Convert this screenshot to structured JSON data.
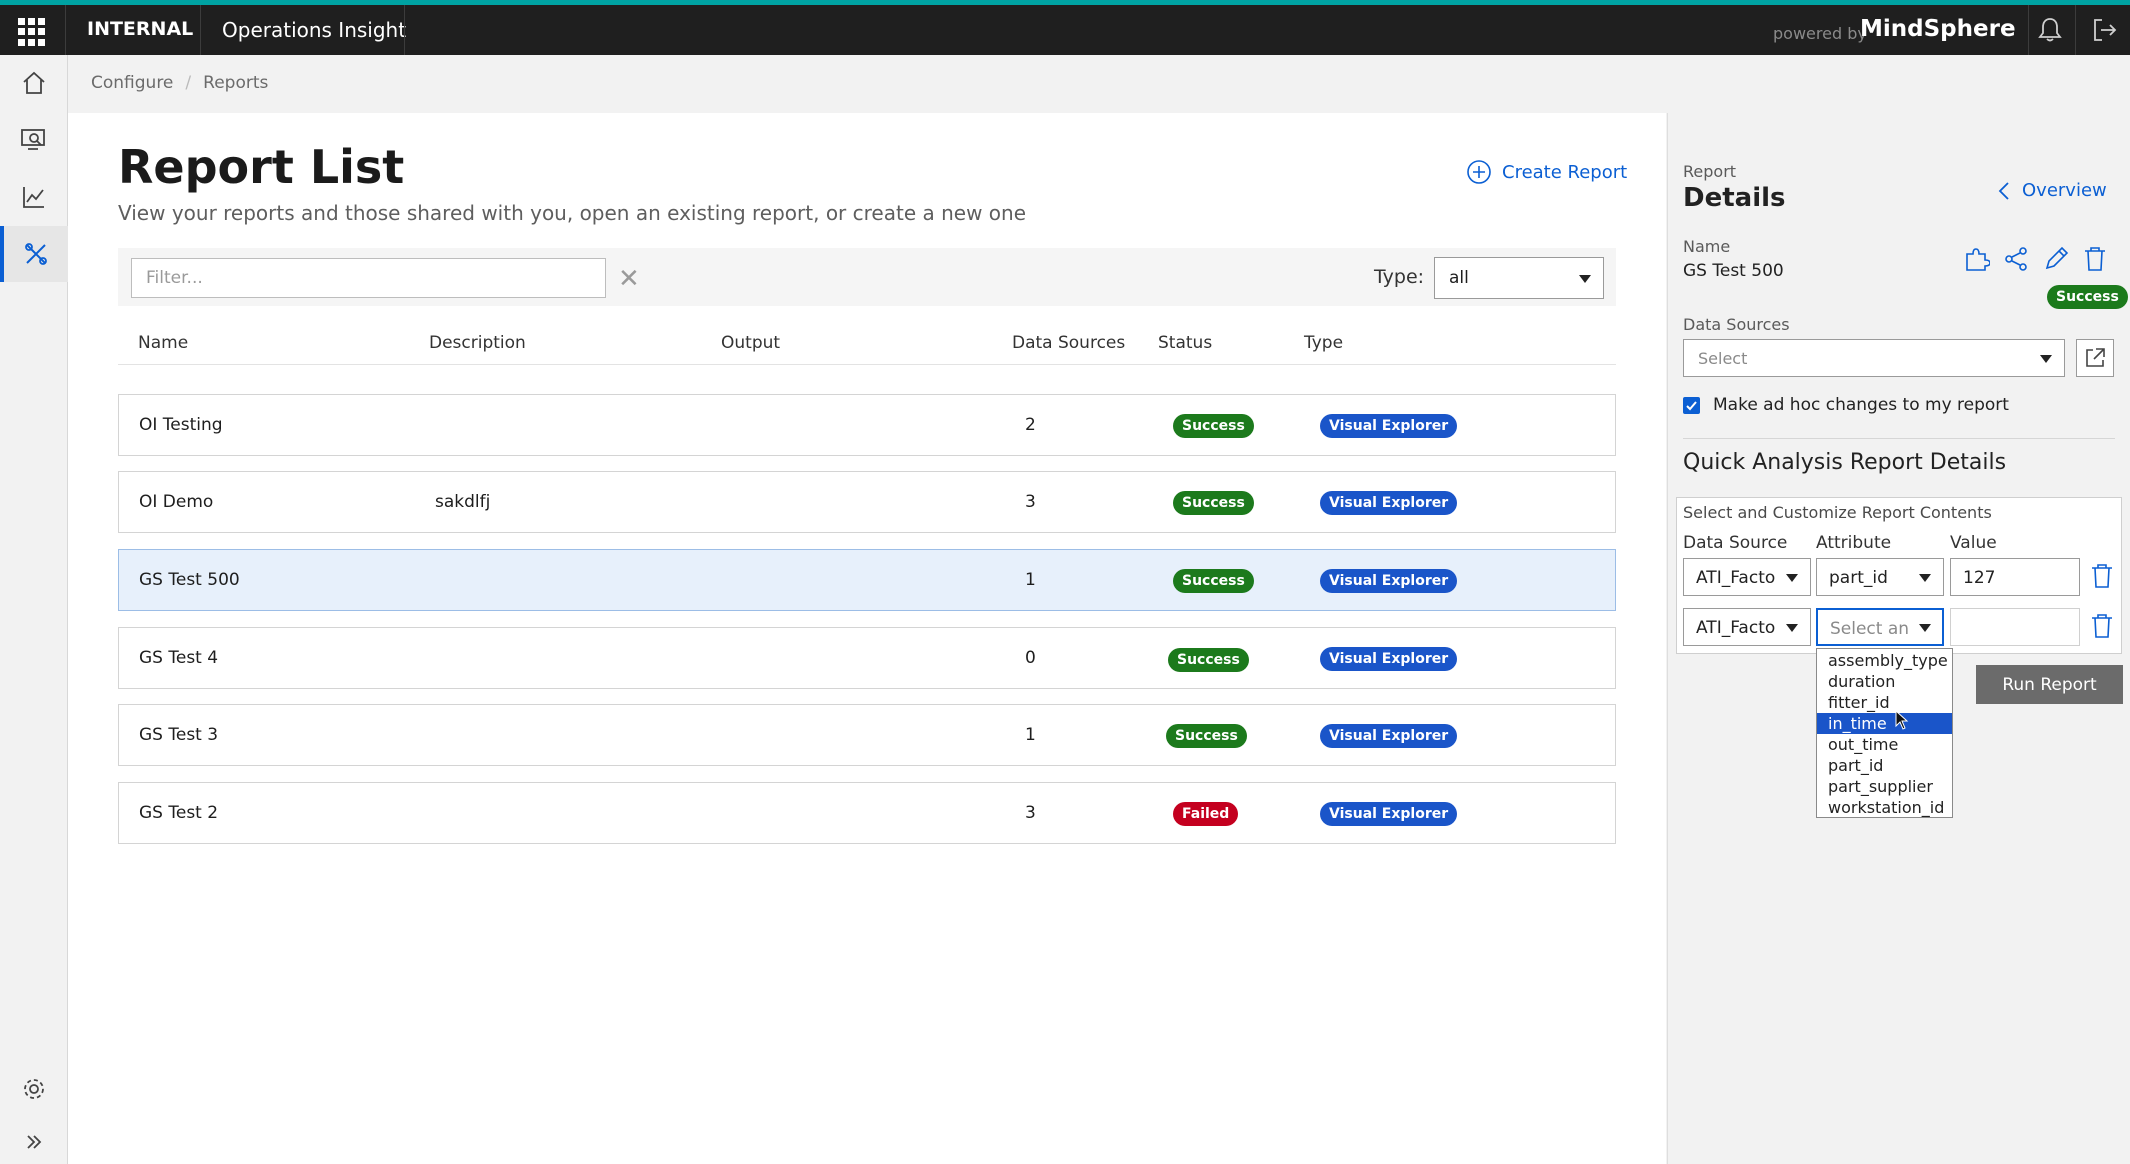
{
  "topbar": {
    "org": "INTERNAL",
    "app_name": "Operations Insight",
    "powered_by": "powered by",
    "brand": "MindSphere"
  },
  "breadcrumb": {
    "items": [
      "Configure",
      "Reports"
    ],
    "separator": "/"
  },
  "main": {
    "title": "Report List",
    "subtitle": "View your reports and those shared with you, open an existing report, or create a new one",
    "create_label": "Create Report",
    "filter": {
      "placeholder": "Filter...",
      "value": ""
    },
    "type_label": "Type:",
    "type_value": "all",
    "columns": [
      "Name",
      "Description",
      "Output",
      "Data Sources",
      "Status",
      "Type"
    ],
    "rows": [
      {
        "name": "OI Testing",
        "description": "",
        "output": "",
        "data_sources": "2",
        "status": "Success",
        "type": "Visual Explorer"
      },
      {
        "name": "OI Demo",
        "description": "sakdlfj",
        "output": "",
        "data_sources": "3",
        "status": "Success",
        "type": "Visual Explorer"
      },
      {
        "name": "GS Test 500",
        "description": "",
        "output": "",
        "data_sources": "1",
        "status": "Success",
        "type": "Visual Explorer",
        "selected": true
      },
      {
        "name": "GS Test 4",
        "description": "",
        "output": "",
        "data_sources": "0",
        "status": "Success",
        "type": "Visual Explorer"
      },
      {
        "name": "GS Test 3",
        "description": "",
        "output": "",
        "data_sources": "1",
        "status": "Success",
        "type": "Visual Explorer"
      },
      {
        "name": "GS Test 2",
        "description": "",
        "output": "",
        "data_sources": "3",
        "status": "Failed",
        "type": "Visual Explorer"
      }
    ]
  },
  "panel": {
    "overline": "Report",
    "title": "Details",
    "overview_label": "Overview",
    "name_label": "Name",
    "name_value": "GS Test 500",
    "status": "Success",
    "data_sources_label": "Data Sources",
    "data_sources_placeholder": "Select",
    "adhoc_label": "Make ad hoc changes to my report",
    "adhoc_checked": true,
    "qa_title": "Quick Analysis Report Details",
    "box_title": "Select and Customize Report Contents",
    "col_ds": "Data Source",
    "col_attr": "Attribute",
    "col_value": "Value",
    "row1": {
      "ds": "ATI_Facto",
      "attr": "part_id",
      "value": "127"
    },
    "row2": {
      "ds": "ATI_Facto",
      "attr_placeholder": "Select an",
      "value": ""
    },
    "run_label": "Run Report",
    "dropdown_options": [
      "assembly_type",
      "duration",
      "fitter_id",
      "in_time",
      "out_time",
      "part_id",
      "part_supplier",
      "workstation_id"
    ],
    "dropdown_highlighted": "in_time"
  },
  "colors": {
    "accent": "#0b5fd3",
    "success": "#1c7a1c",
    "failed": "#c4001f",
    "type_badge": "#1a55c9",
    "topbar": "#1f1f1f"
  }
}
